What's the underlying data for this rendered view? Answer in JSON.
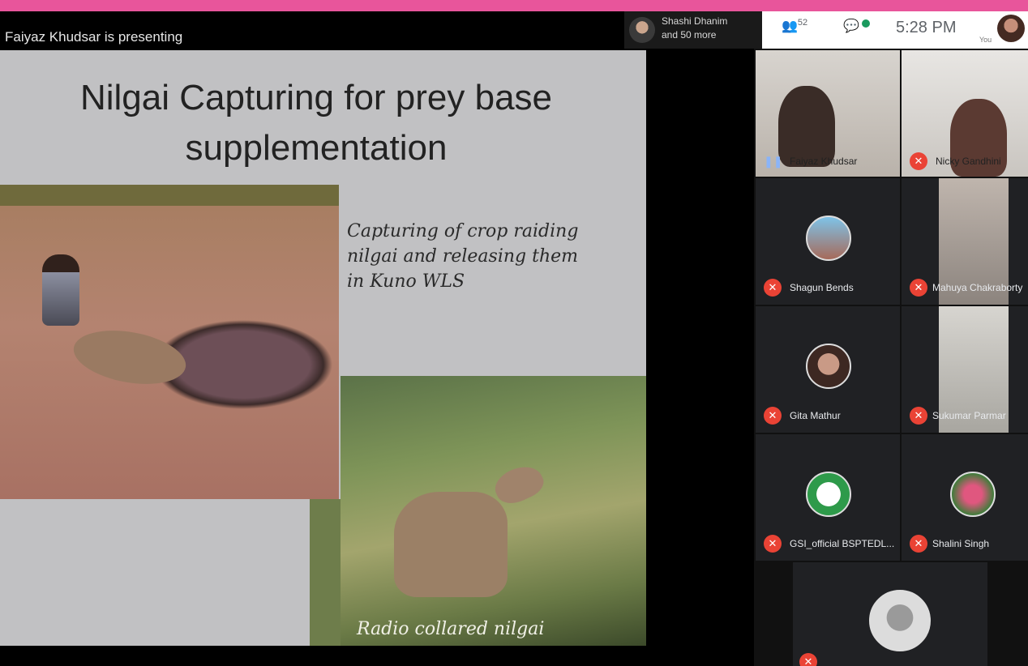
{
  "header": {
    "presenting_text": "Faiyaz Khudsar is presenting",
    "attendee_chip": {
      "line1": "Shashi Dhanim",
      "line2": "and 50 more"
    },
    "people_count": "52",
    "chat_badge": "1",
    "clock": "5:28 PM",
    "self_label": "You"
  },
  "slide": {
    "title_line1": "Nilgai Capturing for prey base",
    "title_line2": "supplementation",
    "caption_top_line1": "Capturing of crop raiding",
    "caption_top_line2": "nilgai and releasing them",
    "caption_top_line3": "in Kuno WLS",
    "caption_bottom": "Radio collared nilgai"
  },
  "participants": [
    {
      "name": "Faiyaz Khudsar",
      "mic": "speaking"
    },
    {
      "name": "Nicky Gandhini",
      "mic": "muted"
    },
    {
      "name": "Shagun Bends",
      "mic": "muted"
    },
    {
      "name": "Mahuya Chakraborty",
      "mic": "muted"
    },
    {
      "name": "Gita Mathur",
      "mic": "muted"
    },
    {
      "name": "Sukumar Parmar",
      "mic": "muted"
    },
    {
      "name": "GSI_official BSPTEDL...",
      "mic": "muted"
    },
    {
      "name": "Shalini Singh",
      "mic": "muted"
    },
    {
      "name": "",
      "mic": "muted"
    }
  ],
  "colors": {
    "accent_stripe": "#e8559b",
    "mic_off": "#ea4335",
    "active_speaker": "#8ab4f8"
  },
  "icons": {
    "people": "people-icon",
    "chat": "chat-icon",
    "mic_off": "mic-off-icon",
    "mic_on": "mic-on-icon"
  }
}
